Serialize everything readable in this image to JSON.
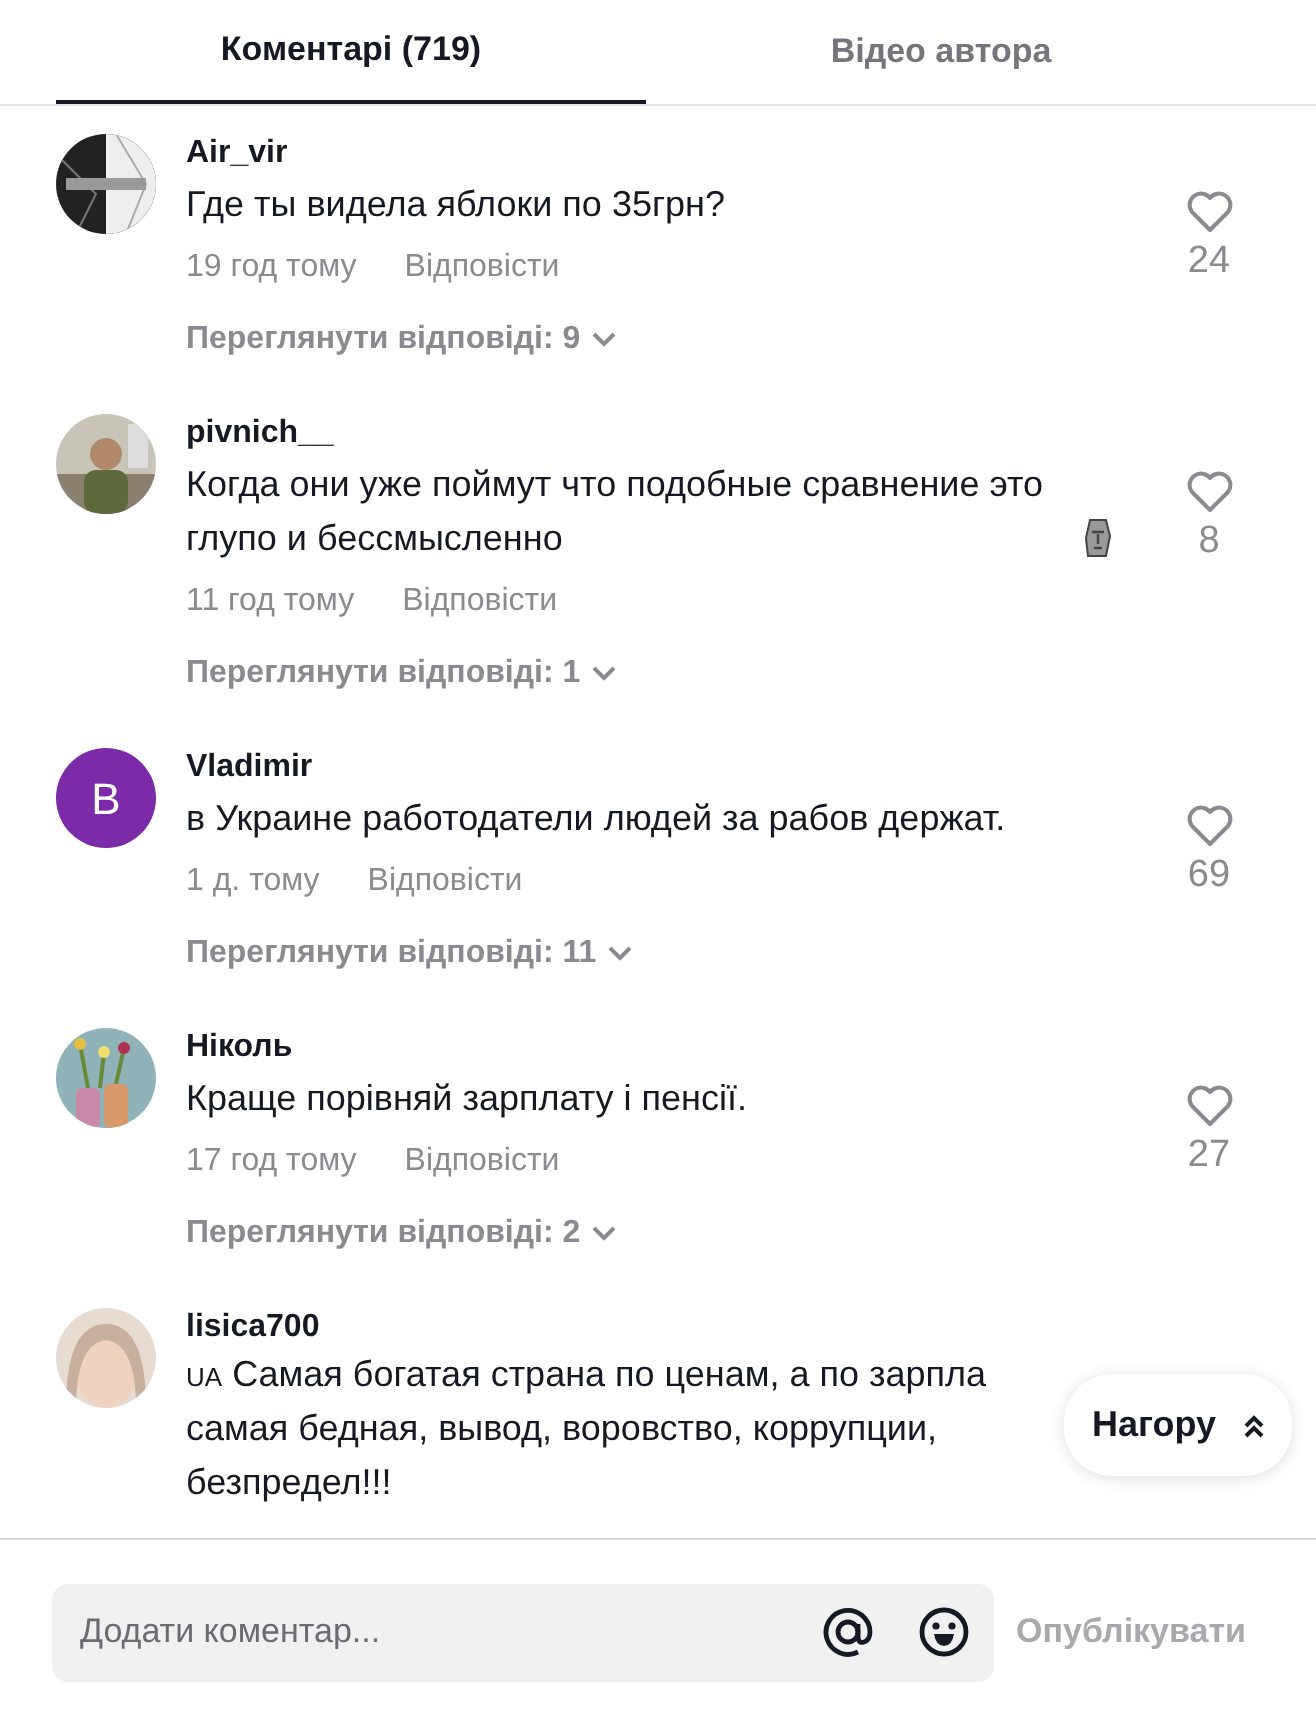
{
  "tabs": [
    {
      "label": "Коментарі (719)",
      "selected": true
    },
    {
      "label": "Відео автора",
      "selected": false
    }
  ],
  "comments": [
    {
      "author": "Air_vir",
      "text": "Где ты видела яблоки по 35грн?",
      "time": "19 год тому",
      "reply": "Відповісти",
      "likes": "24",
      "view_replies": "Переглянути відповіді: 9"
    },
    {
      "author": "pivnich__",
      "text": "Когда они уже поймут что подобные сравнение это глупо и бессмысленно",
      "emoji": true,
      "time": "11 год тому",
      "reply": "Відповісти",
      "likes": "8",
      "view_replies": "Переглянути відповіді: 1"
    },
    {
      "author": "Vladimir",
      "avatar": {
        "kind": "letter",
        "letter": "B",
        "color": "#7b2aa8"
      },
      "text": "в Украине работодатели людей за рабов держат.",
      "time": "1 д. тому",
      "reply": "Відповісти",
      "likes": "69",
      "view_replies": "Переглянути відповіді: 11"
    },
    {
      "author": "Ніколь",
      "text": "Краще порівняй зарплату і пенсії.",
      "time": "17 год тому",
      "reply": "Відповісти",
      "likes": "27",
      "view_replies": "Переглянути відповіді: 2"
    },
    {
      "author": "lisica700",
      "flag": "UA",
      "lines": [
        "Самая богатая страна по ценам, а по зарпла",
        "самая бедная, вывод, воровство, коррупции,",
        "безпредел!!!"
      ]
    }
  ],
  "scroll_top": {
    "label": "Нагору"
  },
  "composer": {
    "placeholder": "Додати коментар...",
    "post": "Опублікувати",
    "post_disabled": true
  }
}
